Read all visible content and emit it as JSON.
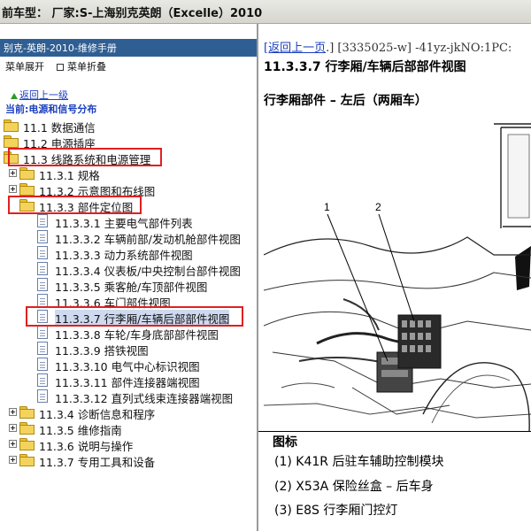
{
  "header": {
    "title": "前车型： 厂家:S-上海别克英朗（Excelle）2010"
  },
  "left_panel": {
    "title": "别克-英朗-2010-维修手册",
    "menu_expand": "菜单展开",
    "menu_collapse": "菜单折叠",
    "back_link": "返回上一级",
    "current_location": "当前:电源和信号分布",
    "tree": [
      {
        "label": "11.1 数据通信"
      },
      {
        "label": "11.2 电源插座"
      },
      {
        "label": "11.3 线路系统和电源管理"
      },
      {
        "label": "11.3.1 规格"
      },
      {
        "label": "11.3.2 示意图和布线图"
      },
      {
        "label": "11.3.3 部件定位图"
      },
      {
        "label": "11.3.3.1 主要电气部件列表"
      },
      {
        "label": "11.3.3.2 车辆前部/发动机舱部件视图"
      },
      {
        "label": "11.3.3.3 动力系统部件视图"
      },
      {
        "label": "11.3.3.4 仪表板/中央控制台部件视图"
      },
      {
        "label": "11.3.3.5 乘客舱/车顶部件视图"
      },
      {
        "label": "11.3.3.6 车门部件视图"
      },
      {
        "label": "11.3.3.7 行李厢/车辆后部部件视图"
      },
      {
        "label": "11.3.3.8 车轮/车身底部部件视图"
      },
      {
        "label": "11.3.3.9 搭铁视图"
      },
      {
        "label": "11.3.3.10 电气中心标识视图"
      },
      {
        "label": "11.3.3.11 部件连接器端视图"
      },
      {
        "label": "11.3.3.12 直列式线束连接器端视图"
      },
      {
        "label": "11.3.4 诊断信息和程序"
      },
      {
        "label": "11.3.5 维修指南"
      },
      {
        "label": "11.3.6 说明与操作"
      },
      {
        "label": "11.3.7 专用工具和设备"
      }
    ]
  },
  "right_panel": {
    "nav_back": "[返回上一页",
    "nav_rest": ".] [3335025-w] -41yz-jkNO:1PC:",
    "doc_title": "11.3.3.7 行李厢/车辆后部部件视图",
    "section_title": "行李厢部件 – 左后（两厢车）",
    "callout_1": "1",
    "callout_2": "2",
    "legend_title": "图标",
    "legend_items": [
      "(1) K41R 后驻车辅助控制模块",
      "(2) X53A 保险丝盒 – 后车身",
      "(3) E8S 行李厢门控灯"
    ]
  },
  "colors": {
    "panel_header": "#2f5e93",
    "highlight_box": "#e02020",
    "link": "#1a3fbf"
  }
}
